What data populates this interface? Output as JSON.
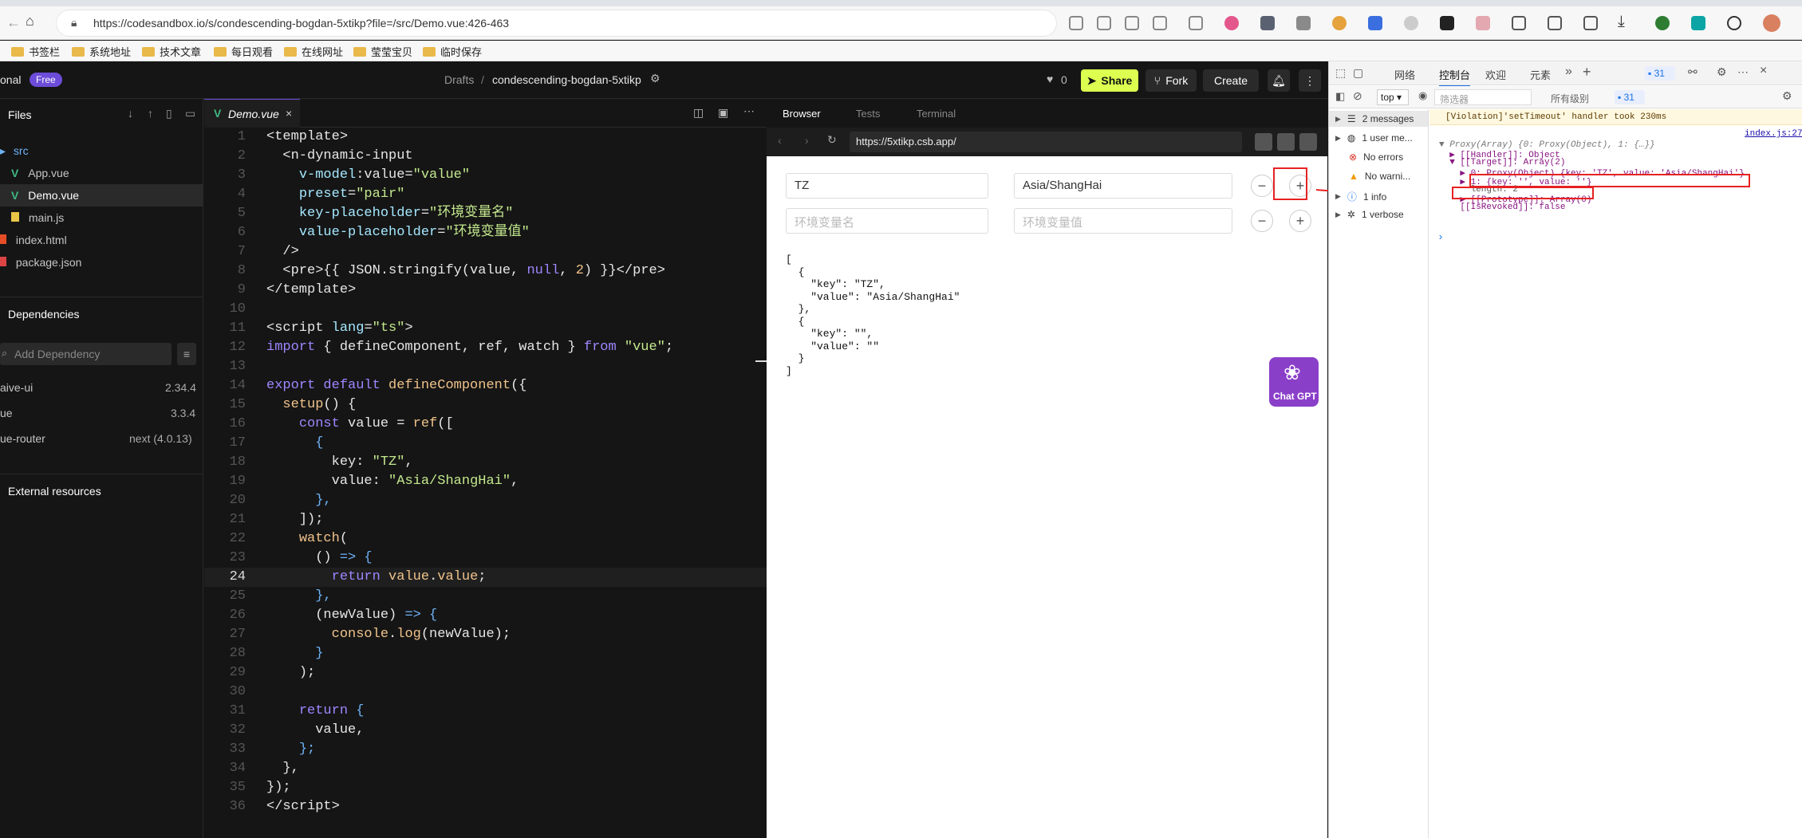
{
  "browser": {
    "url": "https://codesandbox.io/s/condescending-bogdan-5xtikp?file=/src/Demo.vue:426-463",
    "bookmarks": [
      "书签栏",
      "系统地址",
      "技术文章",
      "每日观看",
      "在线网址",
      "莹莹宝贝",
      "临时保存"
    ]
  },
  "csb": {
    "plan_label": "onal",
    "plan_badge": "Free",
    "breadcrumb_root": "Drafts",
    "breadcrumb_sep": "/",
    "sandbox_name": "condescending-bogdan-5xtikp",
    "likes": "0",
    "share_label": "Share",
    "fork_label": "Fork",
    "create_label": "Create"
  },
  "sidebar": {
    "files_title": "Files",
    "files": [
      {
        "name": "src",
        "type": "folder"
      },
      {
        "name": "App.vue",
        "type": "vue"
      },
      {
        "name": "Demo.vue",
        "type": "vue"
      },
      {
        "name": "main.js",
        "type": "js"
      },
      {
        "name": "index.html",
        "type": "html"
      },
      {
        "name": "package.json",
        "type": "json"
      }
    ],
    "deps_title": "Dependencies",
    "add_dep_placeholder": "Add Dependency",
    "deps": [
      {
        "name": "aive-ui",
        "version": "2.34.4"
      },
      {
        "name": "ue",
        "version": "3.3.4"
      },
      {
        "name": "ue-router",
        "version": "next (4.0.13)"
      }
    ],
    "external_title": "External resources"
  },
  "editor": {
    "tab_name": "Demo.vue",
    "current_line": "24"
  },
  "preview": {
    "tabs": [
      "Browser",
      "Tests",
      "Terminal"
    ],
    "url": "https://5xtikp.csb.app/",
    "rows": [
      {
        "key": "TZ",
        "value": "Asia/ShangHai",
        "key_placeholder": "",
        "value_placeholder": ""
      },
      {
        "key": "",
        "value": "",
        "key_placeholder": "环境变量名",
        "value_placeholder": "环境变量值"
      }
    ],
    "minus": "−",
    "plus": "+",
    "json_lines": [
      "[",
      "  {",
      "    \"key\": \"TZ\",",
      "    \"value\": \"Asia/ShangHai\"",
      "  },",
      "  {",
      "    \"key\": \"\",",
      "    \"value\": \"\"",
      "  }",
      "]"
    ],
    "chatgpt_label": "Chat GPT"
  },
  "devtools": {
    "tabs": [
      "网络",
      "控制台",
      "欢迎",
      "元素"
    ],
    "issues_count": "31",
    "context": "top",
    "filter_placeholder": "筛选器",
    "levels": "所有级别",
    "levels_count": "31",
    "side_items": [
      {
        "label": "2 messages",
        "icon": "list-icon"
      },
      {
        "label": "1 user me...",
        "icon": "user-icon"
      },
      {
        "label": "No errors",
        "icon": "error-icon"
      },
      {
        "label": "No warni...",
        "icon": "warning-icon"
      },
      {
        "label": "1 info",
        "icon": "info-icon"
      },
      {
        "label": "1 verbose",
        "icon": "bug-icon"
      }
    ],
    "violation": "[Violation]'setTimeout' handler took 230ms",
    "source_link": "index.js:27",
    "log_lines": [
      "▼ Proxy(Array) {0: Proxy(Object), 1: {…}}",
      "  ▶ [[Handler]]: Object",
      "  ▼ [[Target]]: Array(2)",
      "    ▶ 0: Proxy(Object) {key: 'TZ', value: 'Asia/ShangHai'}",
      "    ▶ 1: {key: '', value: ''}",
      "      length: 2",
      "    ▶ [[Prototype]]: Array(0)",
      "    [[IsRevoked]]: false"
    ],
    "prompt": "›"
  }
}
